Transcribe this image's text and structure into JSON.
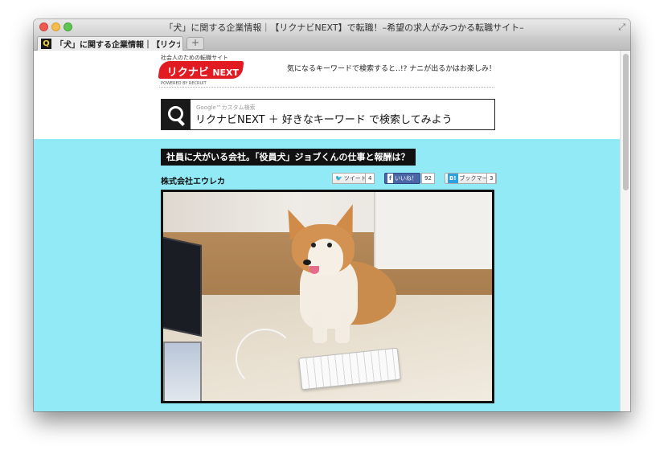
{
  "window": {
    "title": "「犬」に関する企業情報｜【リクナビNEXT】で転職！–希望の求人がみつかる転職サイト–",
    "fullscreen_icon": "fullscreen-arrows-icon"
  },
  "tabs": [
    {
      "label": "「犬」に関する企業情報｜【リクナ…",
      "favicon": "search-favicon-icon",
      "active": true
    }
  ],
  "new_tab_label": "+",
  "site": {
    "tagline": "社会人のための転職サイト",
    "logo_main": "リクナビ",
    "logo_next": "NEXT",
    "powered_by": "POWERED BY RECRUIT",
    "header_message": "気になるキーワードで検索すると‥!? ナニが出るかはお楽しみ！",
    "brand_color": "#e21a22"
  },
  "search": {
    "gcs_label": "Google™カスタム検索",
    "text": "リクナビNEXT ＋ 好きなキーワード で検索してみよう",
    "icon": "search-icon"
  },
  "article": {
    "background": "#92eaf6",
    "title": "社員に犬がいる会社。「役員犬」ジョブくんの仕事と報酬は？",
    "company": "株式会社エウレカ",
    "tweet_label": "ツイート",
    "tweet_count": "4",
    "like_label": "いいね！",
    "like_count": "92",
    "bookmark_label": "ブックマーク",
    "bookmark_icon": "B!",
    "bookmark_count": "3",
    "photo": "corgi-at-desk-photo"
  }
}
